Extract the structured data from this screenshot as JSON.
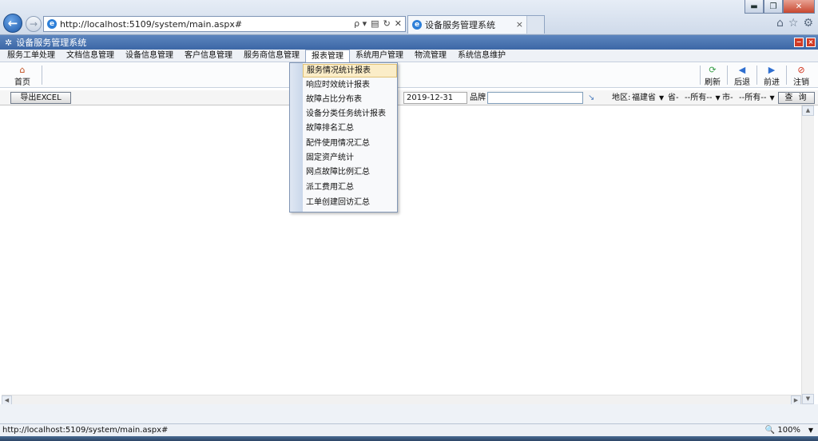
{
  "browser": {
    "url": "http://localhost:5109/system/main.aspx#",
    "tab_title": "设备服务管理系统",
    "win_minimize": "▬",
    "win_maximize": "❐",
    "win_close": "✕",
    "back_glyph": "←",
    "forward_glyph": "→",
    "page_icon": "e",
    "search_glyph": "ρ ▾",
    "compat_glyph": "▤",
    "refresh_glyph": "↻",
    "stop_glyph": "✕",
    "tab_close_glyph": "×",
    "home_glyph": "⌂",
    "favorites_glyph": "☆",
    "tools_glyph": "⚙"
  },
  "app": {
    "title": "设备服务管理系统",
    "gear_glyph": "✲",
    "minimize_glyph": "−",
    "close_glyph": "×"
  },
  "menu": [
    {
      "label": "服务工单处理"
    },
    {
      "label": "文档信息管理"
    },
    {
      "label": "设备信息管理"
    },
    {
      "label": "客户信息管理"
    },
    {
      "label": "服务商信息管理"
    },
    {
      "label": "报表管理"
    },
    {
      "label": "系统用户管理"
    },
    {
      "label": "物流管理"
    },
    {
      "label": "系统信息维护"
    }
  ],
  "toolbar": {
    "home": {
      "label": "首页",
      "icon": "home-icon",
      "glyph": "⌂"
    },
    "refresh": {
      "label": "刷新",
      "icon": "refresh-icon",
      "glyph": "⟳"
    },
    "back": {
      "label": "后退",
      "icon": "back-icon",
      "glyph": "◀"
    },
    "forward": {
      "label": "前进",
      "icon": "forward-icon",
      "glyph": "▶"
    },
    "logout": {
      "label": "注销",
      "icon": "logout-icon",
      "glyph": "⊘"
    }
  },
  "filters": {
    "export_label": "导出EXCEL",
    "date_end": "2019-12-31",
    "brand_label": "品牌",
    "brand_value": "",
    "search_glyph": "↘",
    "region_label": "地区:",
    "region_value": "福建省",
    "province_label": "省-",
    "province_value": "--所有--",
    "city_label": "市-",
    "city_value": "--所有--",
    "dropdown_glyph": "▼",
    "query_label": "查 询"
  },
  "report_menu": {
    "highlighted_index": 0,
    "items": [
      {
        "label": "服务情况统计报表"
      },
      {
        "label": "响应时效统计报表"
      },
      {
        "label": "故障占比分布表"
      },
      {
        "label": "设备分类任务统计报表"
      },
      {
        "label": "故障排名汇总"
      },
      {
        "label": "配件使用情况汇总"
      },
      {
        "label": "固定资产统计"
      },
      {
        "label": "网点故障比例汇总"
      },
      {
        "label": "派工费用汇总"
      },
      {
        "label": "工单创建回访汇总"
      }
    ]
  },
  "status": {
    "url": "http://localhost:5109/system/main.aspx#",
    "zoom": "100%",
    "zoom_glyph": "🔍",
    "zoom_arrow": "▼"
  },
  "scroll": {
    "up": "▲",
    "down": "▼",
    "left": "◀",
    "right": "▶"
  },
  "colors": {
    "app_titlebar": "#3c67a6",
    "menu_highlight": "#fbedc8",
    "logout_icon": "#d03018",
    "refresh_icon": "#3aa04a",
    "nav_icon": "#2f6fd0"
  }
}
